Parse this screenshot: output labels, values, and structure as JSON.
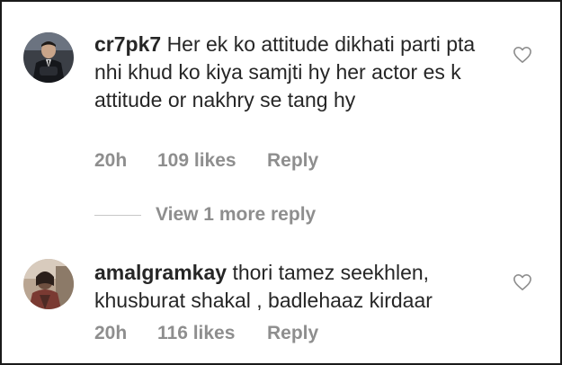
{
  "comments": [
    {
      "username": "cr7pk7",
      "text": "Her ek ko attitude dikhati parti pta nhi khud ko kiya samjti hy her actor es k attitude or nakhry se tang hy",
      "time": "20h",
      "likes": "109 likes",
      "reply": "Reply",
      "avatar_icon": "user-avatar-suit"
    },
    {
      "username": "amalgramkay",
      "text": "thori tamez seekhlen, khusburat shakal , badlehaaz kirdaar",
      "time": "20h",
      "likes": "116 likes",
      "reply": "Reply",
      "avatar_icon": "user-avatar-photo"
    }
  ],
  "view_more": {
    "label": "View 1 more reply"
  },
  "colors": {
    "text": "#262626",
    "secondary": "#8e8e8e",
    "border": "#1a1a1a"
  }
}
